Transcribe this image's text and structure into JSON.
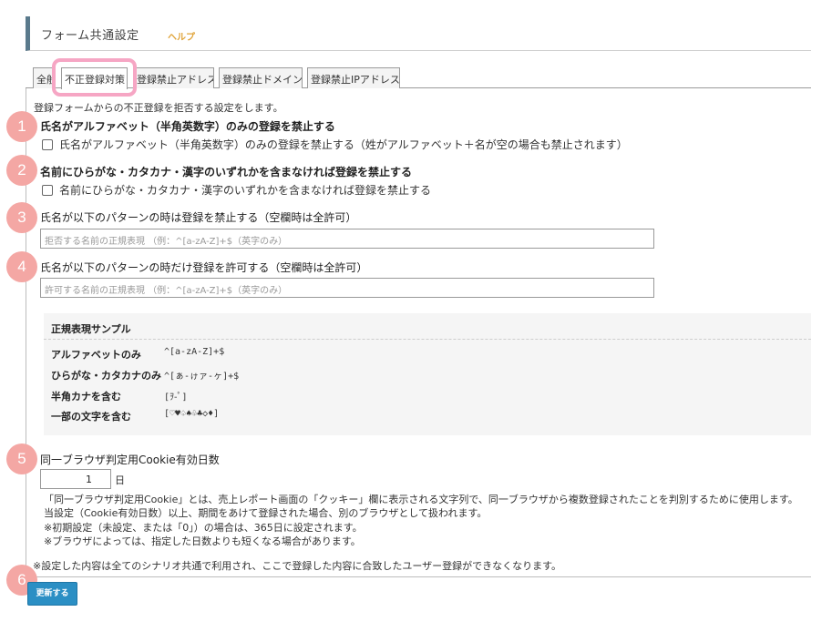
{
  "header": {
    "title": "フォーム共通設定",
    "help": "ヘルプ"
  },
  "tabs": [
    {
      "label": "全般"
    },
    {
      "label": "不正登録対策"
    },
    {
      "label": "登録禁止アドレス"
    },
    {
      "label": "登録禁止ドメイン"
    },
    {
      "label": "登録禁止IPアドレス"
    }
  ],
  "intro": "登録フォームからの不正登録を拒否する設定をします。",
  "sections": {
    "s1": {
      "badge": "1",
      "title": "氏名がアルファベット（半角英数字）のみの登録を禁止する",
      "checkbox": "氏名がアルファベット（半角英数字）のみの登録を禁止する（姓がアルファベット＋名が空の場合も禁止されます）"
    },
    "s2": {
      "badge": "2",
      "title": "名前にひらがな・カタカナ・漢字のいずれかを含まなければ登録を禁止する",
      "checkbox": "名前にひらがな・カタカナ・漢字のいずれかを含まなければ登録を禁止する"
    },
    "s3": {
      "badge": "3",
      "title": "氏名が以下のパターンの時は登録を禁止する（空欄時は全許可）",
      "placeholder": "拒否する名前の正規表現 （例：^[a-zA-Z]+$（英字のみ）"
    },
    "s4": {
      "badge": "4",
      "title": "氏名が以下のパターンの時だけ登録を許可する（空欄時は全許可）",
      "placeholder": "許可する名前の正規表現 （例：^[a-zA-Z]+$（英字のみ）"
    },
    "s5": {
      "badge": "5",
      "title": "同一ブラウザ判定用Cookie有効日数",
      "value": "1",
      "unit": "日"
    },
    "s6": {
      "badge": "6"
    }
  },
  "sample": {
    "title": "正規表現サンプル",
    "rows": [
      {
        "label": "アルファベットのみ",
        "value": "^[a-zA-Z]+$"
      },
      {
        "label": "ひらがな・カタカナのみ",
        "value": "^[ぁ-ゖァ-ヶ]+$"
      },
      {
        "label": "半角カナを含む",
        "value": "[ｦ-ﾟ]"
      },
      {
        "label": "一部の文字を含む",
        "value": "[♡♥♤♠♧♣◇♦]"
      }
    ]
  },
  "cookie_notes": [
    "「同一ブラウザ判定用Cookie」とは、売上レポート画面の「クッキー」欄に表示される文字列で、同一ブラウザから複数登録されたことを判別するために使用します。",
    "当設定（Cookie有効日数）以上、期間をあけて登録された場合、別のブラウザとして扱われます。",
    "※初期設定（未設定、または「0」）の場合は、365日に設定されます。",
    "※ブラウザによっては、指定した日数よりも短くなる場合があります。"
  ],
  "footer_note": "※設定した内容は全てのシナリオ共通で利用され、ここで登録した内容に合致したユーザー登録ができなくなります。",
  "update_button": "更新する",
  "colors": {
    "accent": "#2b8fc4",
    "badge": "#f4a7a4",
    "highlight": "#f6a6c4",
    "help": "#e0a43a"
  }
}
